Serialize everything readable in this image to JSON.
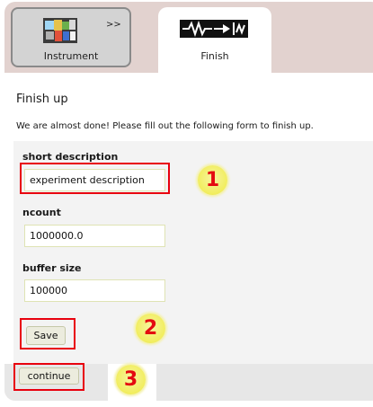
{
  "tabs": {
    "instrument": {
      "label": "Instrument",
      "icon": "instrument-thumbnail-icon"
    },
    "separator": ">>",
    "finish": {
      "label": "Finish",
      "icon": "finish-logo-icon"
    }
  },
  "page": {
    "heading": "Finish up",
    "intro": "We are almost done! Please fill out the following form to finish up."
  },
  "form": {
    "short_description": {
      "label": "short description",
      "value": "experiment description"
    },
    "ncount": {
      "label": "ncount",
      "value": "1000000.0"
    },
    "buffer_size": {
      "label": "buffer size",
      "value": "100000"
    },
    "save_label": "Save",
    "continue_label": "continue"
  },
  "markers": {
    "m1": "1",
    "m2": "2",
    "m3": "3"
  },
  "colors": {
    "highlight": "#e8000e",
    "marker_fill": "#f1ed5d",
    "tab_bar": "#e2d2cf"
  }
}
